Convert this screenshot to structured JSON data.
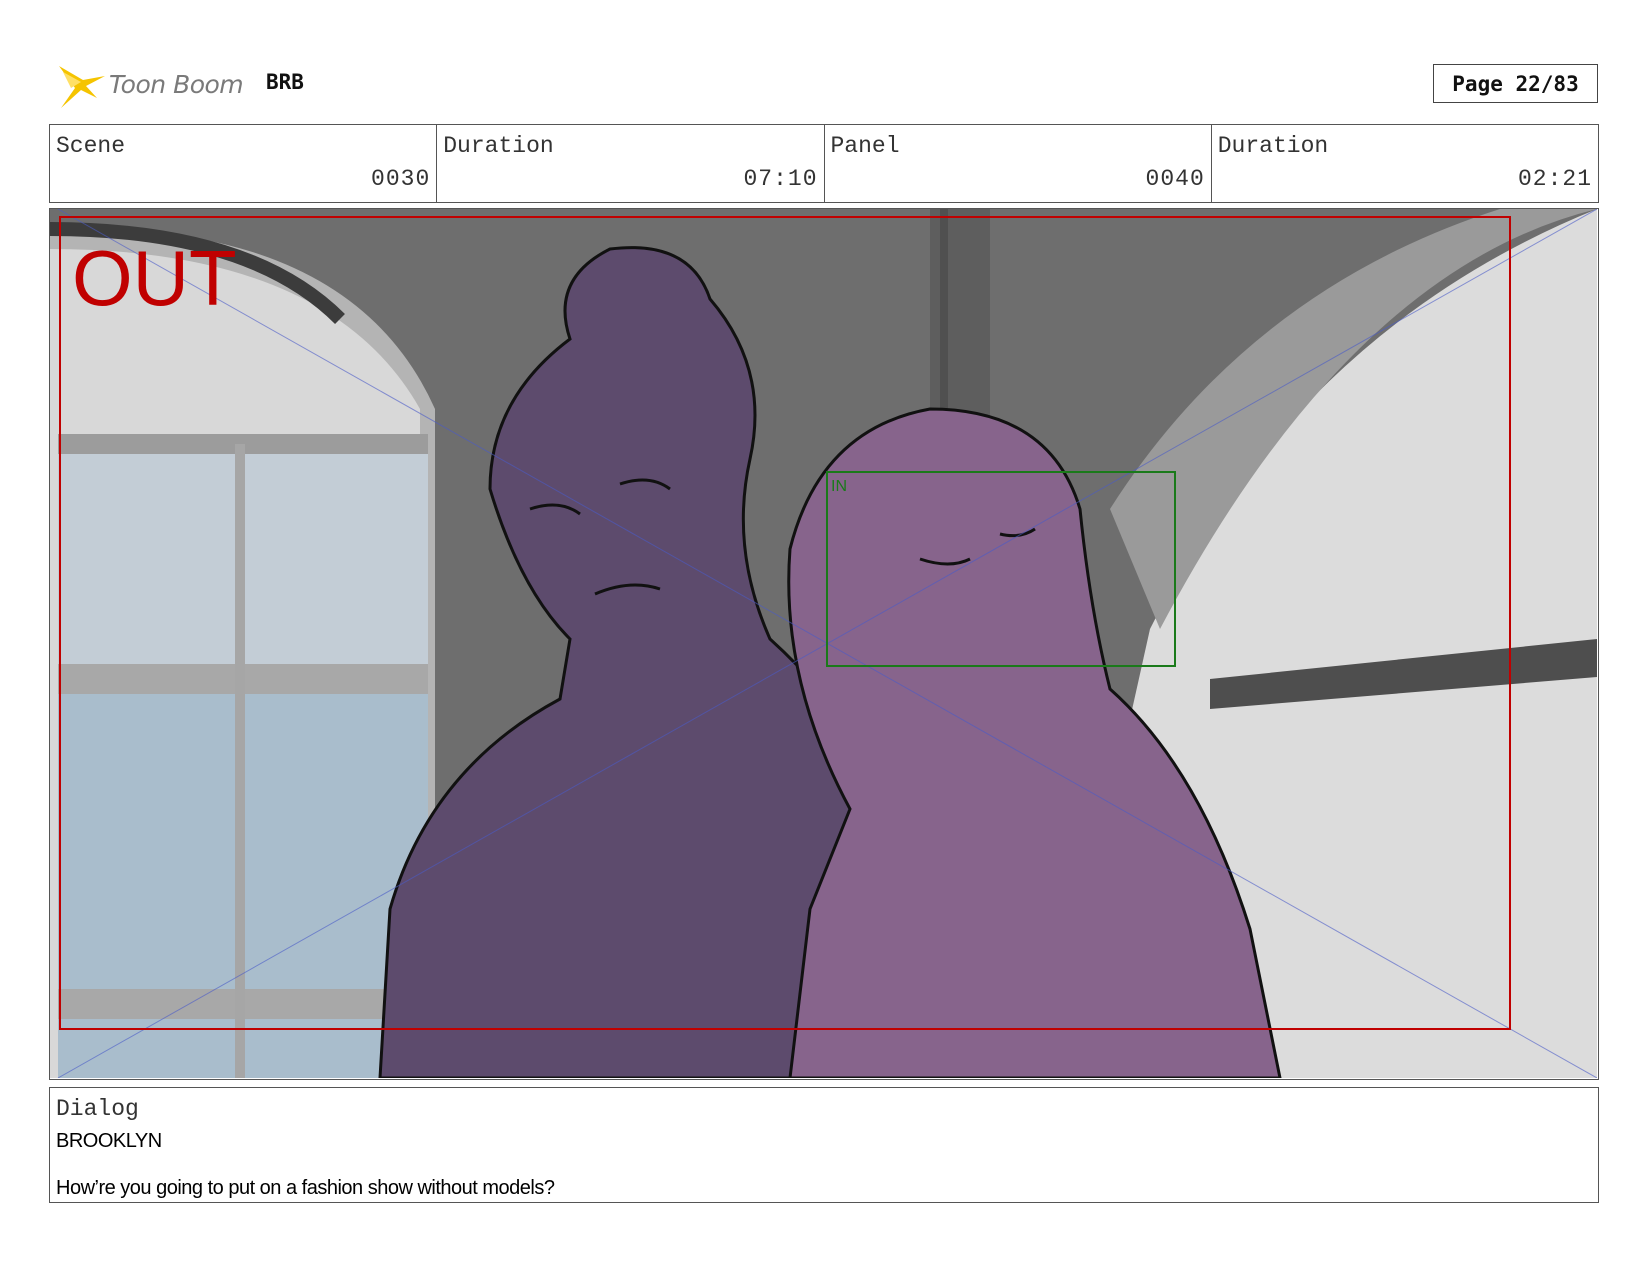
{
  "header": {
    "logo_text": "Toon Boom",
    "project": "BRB",
    "page": "Page 22/83"
  },
  "info": {
    "scene_label": "Scene",
    "scene_value": "0030",
    "scene_duration_label": "Duration",
    "scene_duration_value": "07:10",
    "panel_label": "Panel",
    "panel_value": "0040",
    "panel_duration_label": "Duration",
    "panel_duration_value": "02:21"
  },
  "panel": {
    "out_marker": "OUT",
    "in_marker": "IN",
    "out_color": "#c00000",
    "in_color": "#1a7a1a"
  },
  "dialog": {
    "label": "Dialog",
    "speaker": "BROOKLYN",
    "line": "How’re you going to put on a fashion show without models?"
  }
}
